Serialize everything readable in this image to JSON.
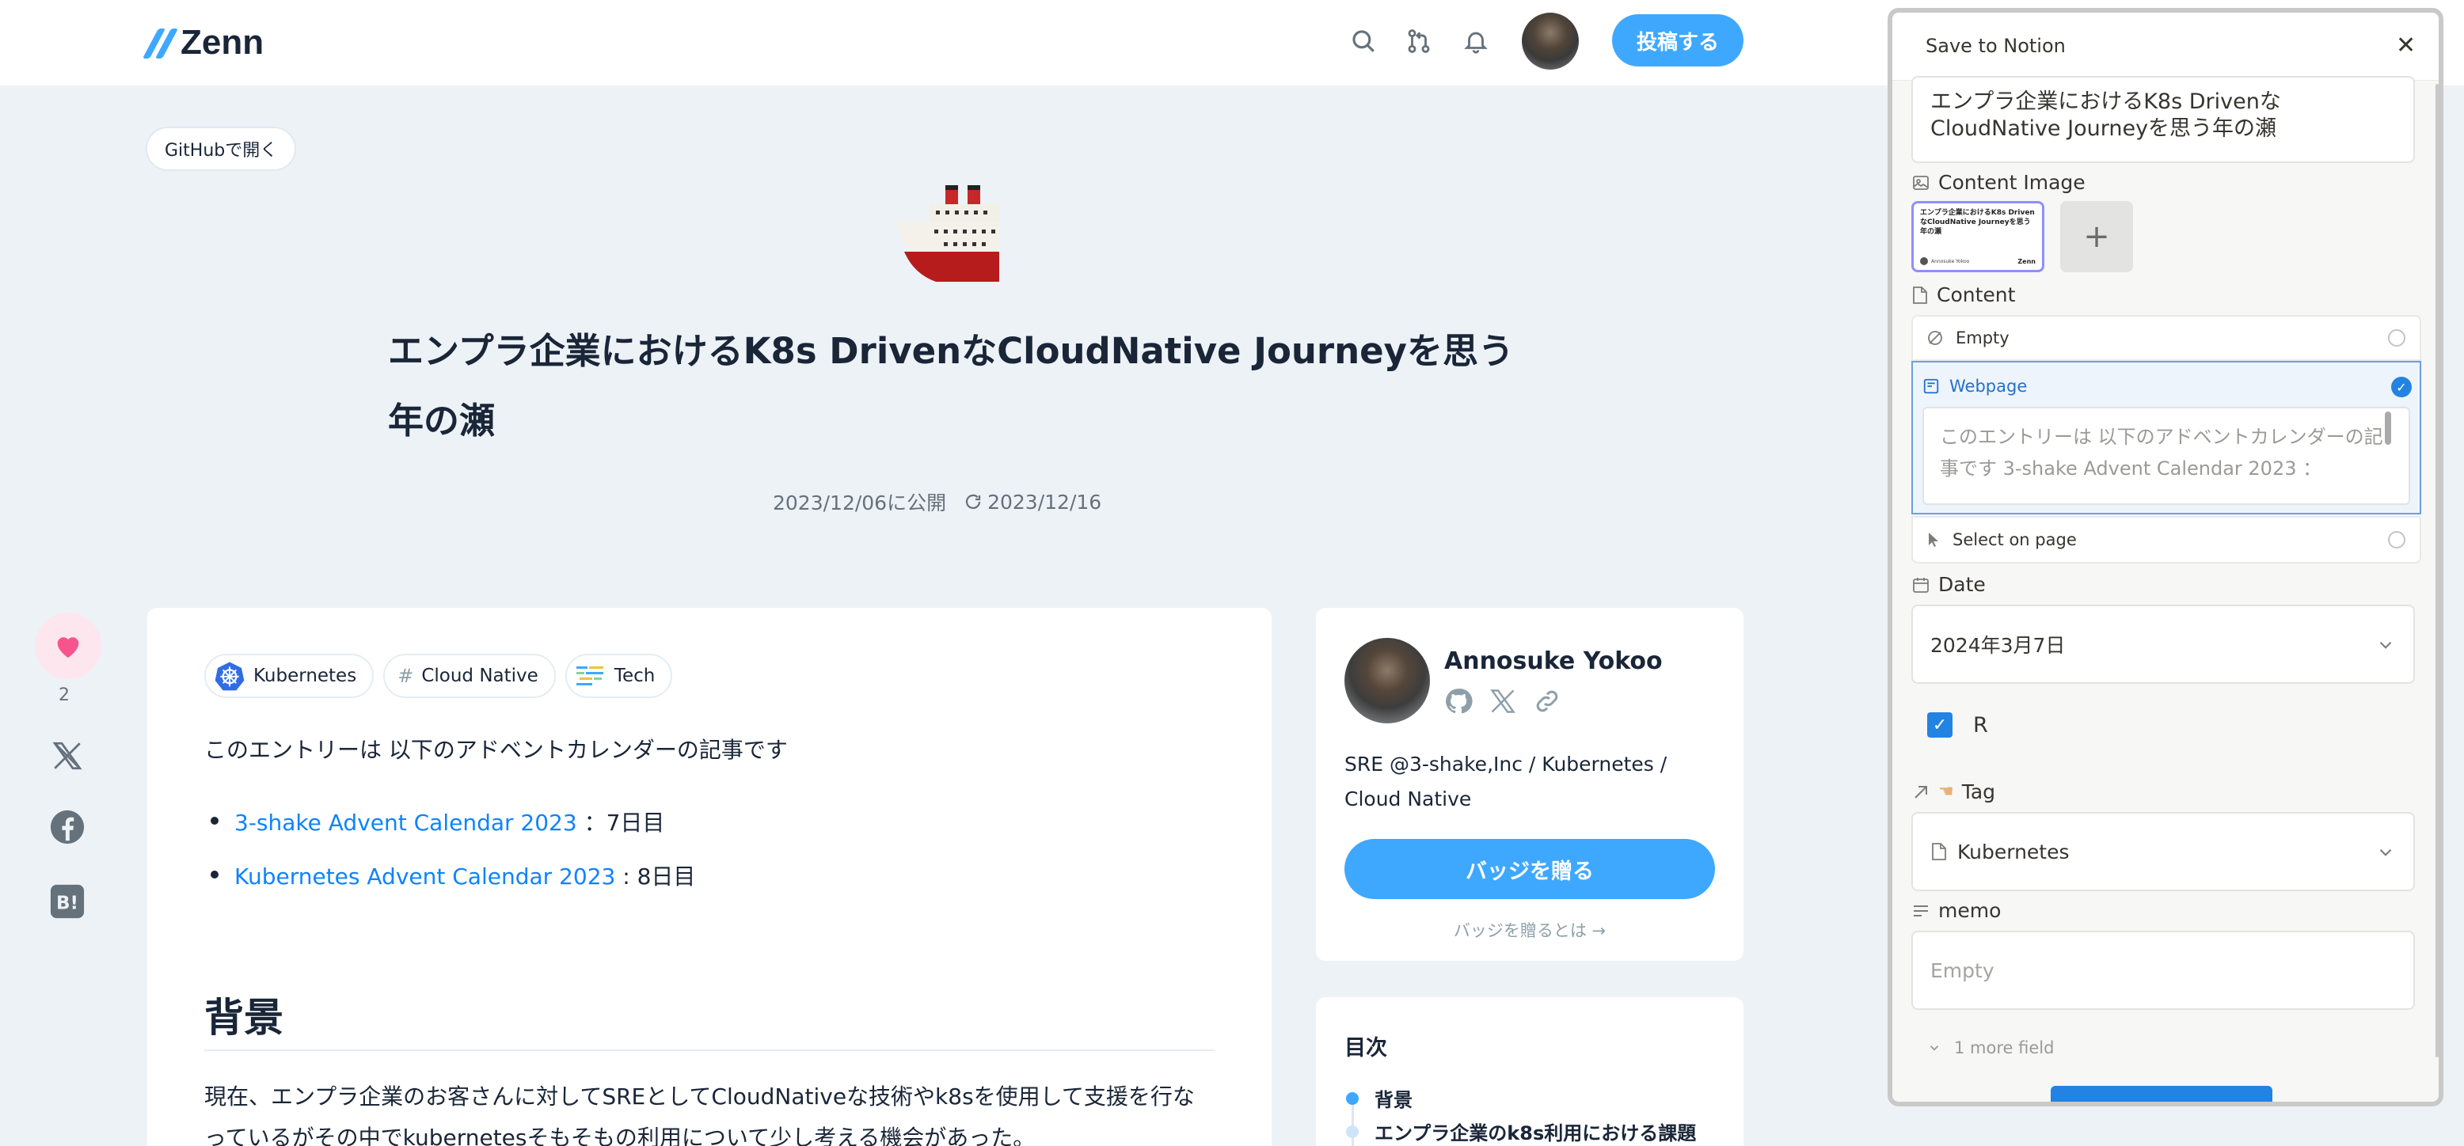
{
  "header": {
    "logo_text": "Zenn",
    "post_button": "投稿する",
    "icons": [
      "search-icon",
      "pull-request-icon",
      "bell-icon",
      "avatar"
    ]
  },
  "article": {
    "github_button": "GitHubで開く",
    "emoji": "ship",
    "title": "エンプラ企業におけるK8s DrivenなCloudNative Journeyを思う年の瀬",
    "published": "2023/12/06に公開",
    "updated": "2023/12/16",
    "likes": "2",
    "tags": [
      {
        "label": "Kubernetes",
        "icon": "kubernetes-icon"
      },
      {
        "label": "Cloud Native",
        "icon": "hash-icon"
      },
      {
        "label": "Tech",
        "icon": "tech-icon"
      }
    ],
    "intro": "このエントリーは 以下のアドベントカレンダーの記事です",
    "links": [
      {
        "text": "3-shake Advent Calendar 2023",
        "suffix": " ：7日目"
      },
      {
        "text": "Kubernetes Advent Calendar 2023",
        "suffix": " : 8日目"
      }
    ],
    "section_heading": "背景",
    "paragraph": "現在、エンプラ企業のお客さんに対してSREとしてCloudNativeな技術やk8sを使用して支援を行なっているがその中でkubernetesそもそもの利用について少し考える機会があった。"
  },
  "author": {
    "name": "Annosuke Yokoo",
    "bio": "SRE @3-shake,Inc / Kubernetes / Cloud Native",
    "badge_button": "バッジを贈る",
    "badge_link": "バッジを贈るとは →"
  },
  "toc": {
    "heading": "目次",
    "items": [
      "背景",
      "エンプラ企業のk8s利用における課題"
    ]
  },
  "notion": {
    "title": "Save to Notion",
    "page_title": "エンプラ企業におけるK8s DrivenなCloudNative Journeyを思う年の瀬",
    "content_image_label": "Content Image",
    "content_label": "Content",
    "options": {
      "empty": "Empty",
      "webpage": "Webpage",
      "select": "Select on page"
    },
    "webpage_preview": "このエントリーは 以下のアドベントカレンダーの記事です 3-shake Advent Calendar 2023 ：",
    "date_label": "Date",
    "date_value": "2024年3月7日",
    "checkbox_label": "R",
    "tag_label": "Tag",
    "tag_value": "Kubernetes",
    "memo_label": "memo",
    "memo_placeholder": "Empty",
    "more_fields": "1 more field",
    "thumb_title": "エンプラ企業におけるK8s DrivenなCloudNative Journeyを思う年の瀬",
    "thumb_author": "Annosuke Yokoo",
    "thumb_brand": "Zenn"
  },
  "colors": {
    "accent": "#3ea8ff",
    "link": "#0f83fd",
    "background": "#edf2f7",
    "notion_blue": "#2383e2"
  }
}
